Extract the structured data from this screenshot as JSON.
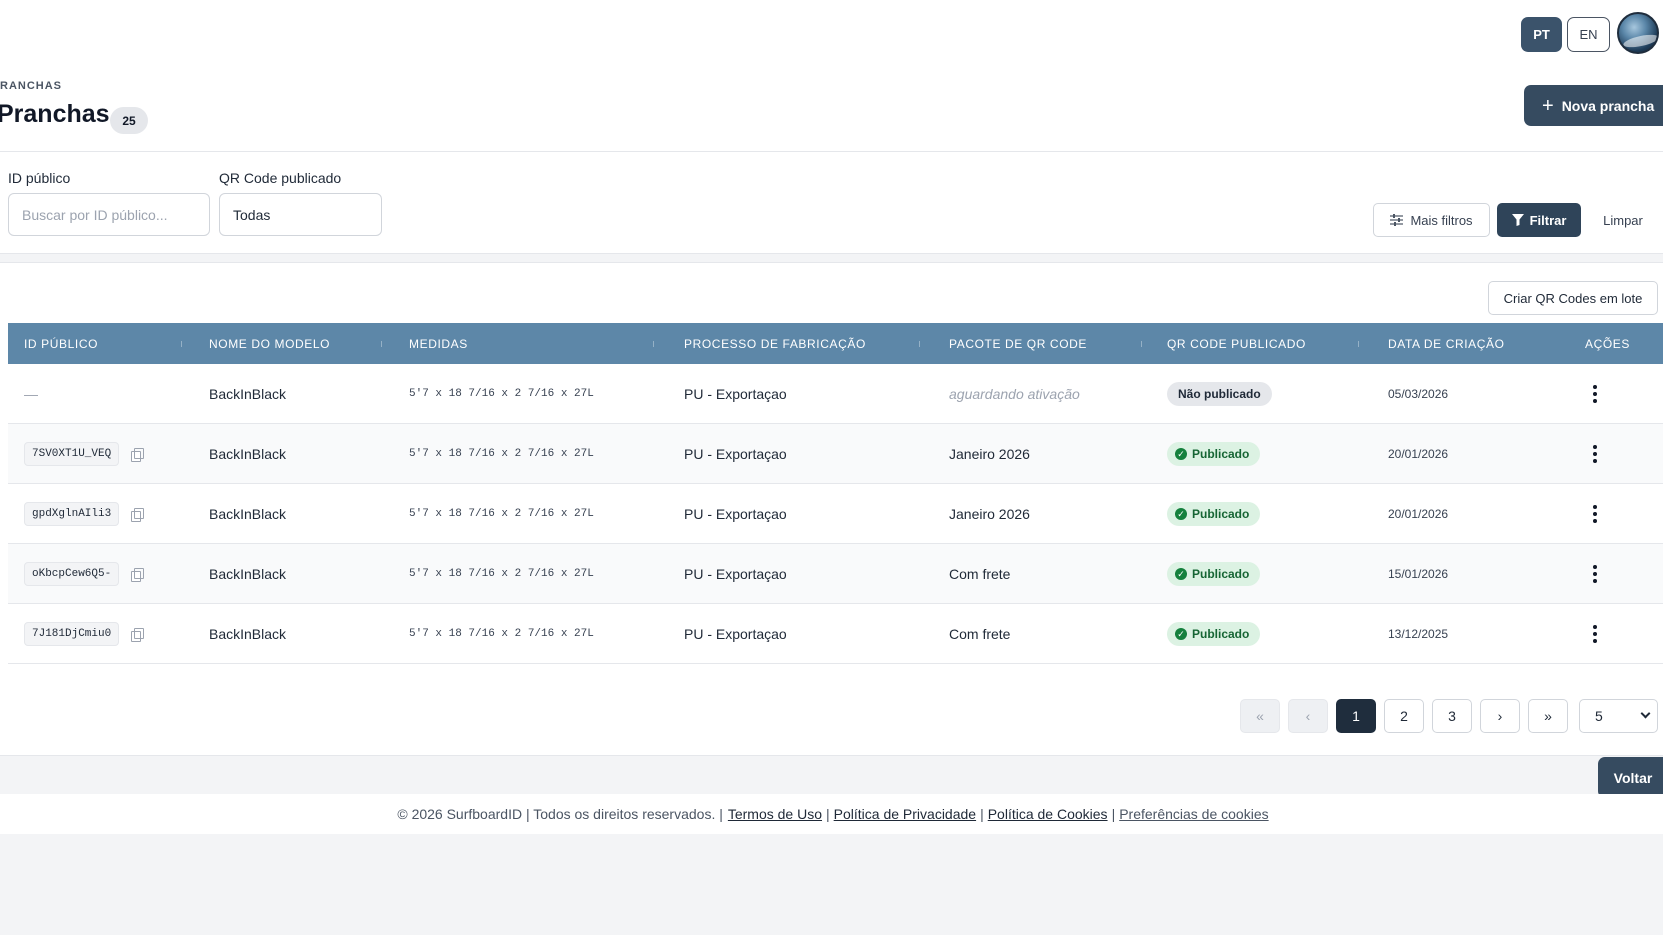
{
  "topbar": {
    "lang_pt": "PT",
    "lang_en": "EN",
    "active_lang": "PT"
  },
  "header": {
    "breadcrumb": "RANCHAS",
    "title": "Pranchas",
    "count": "25",
    "new_button": "Nova prancha"
  },
  "filters": {
    "public_id_label": "ID público",
    "public_id_placeholder": "Buscar por ID público...",
    "qr_label": "QR Code publicado",
    "qr_value": "Todas",
    "more_filters": "Mais filtros",
    "filter": "Filtrar",
    "clear": "Limpar"
  },
  "table": {
    "batch_button": "Criar QR Codes em lote",
    "columns": [
      "ID PÚBLICO",
      "NOME DO MODELO",
      "MEDIDAS",
      "PROCESSO DE FABRICAÇÃO",
      "PACOTE DE QR CODE",
      "QR CODE PUBLICADO",
      "DATA DE CRIAÇÃO",
      "AÇÕES"
    ],
    "rows": [
      {
        "id": "—",
        "model": "BackInBlack",
        "measures": "5'7 x 18 7/16 x 2 7/16 x 27L",
        "process": "PU - Exportaçao",
        "package": "aguardando ativação",
        "published": "Não publicado",
        "date": "05/03/2026"
      },
      {
        "id": "7SV0XT1U_VEQ",
        "model": "BackInBlack",
        "measures": "5'7 x 18 7/16 x 2 7/16 x 27L",
        "process": "PU - Exportaçao",
        "package": "Janeiro 2026",
        "published": "Publicado",
        "date": "20/01/2026"
      },
      {
        "id": "gpdXglnAIli3",
        "model": "BackInBlack",
        "measures": "5'7 x 18 7/16 x 2 7/16 x 27L",
        "process": "PU - Exportaçao",
        "package": "Janeiro 2026",
        "published": "Publicado",
        "date": "20/01/2026"
      },
      {
        "id": "oKbcpCew6Q5-",
        "model": "BackInBlack",
        "measures": "5'7 x 18 7/16 x 2 7/16 x 27L",
        "process": "PU - Exportaçao",
        "package": "Com frete",
        "published": "Publicado",
        "date": "15/01/2026"
      },
      {
        "id": "7J181DjCmiu0",
        "model": "BackInBlack",
        "measures": "5'7 x 18 7/16 x 2 7/16 x 27L",
        "process": "PU - Exportaçao",
        "package": "Com frete",
        "published": "Publicado",
        "date": "13/12/2025"
      }
    ]
  },
  "pagination": {
    "first": "«",
    "prev": "‹",
    "pages": [
      "1",
      "2",
      "3"
    ],
    "current": "1",
    "next": "›",
    "last": "»",
    "per_page": "5"
  },
  "back_button": "Voltar",
  "footer": {
    "copyright": "© 2026 SurfboardID | Todos os direitos reservados. |",
    "terms": "Termos de Uso",
    "privacy": "Política de Privacidade",
    "cookies": "Política de Cookies",
    "cookie_prefs": "Preferências de cookies",
    "separator": "|"
  },
  "colors": {
    "header_bg": "#5d87a8",
    "primary": "#364b60",
    "success_bg": "#dcf2e3",
    "success_text": "#166534"
  }
}
